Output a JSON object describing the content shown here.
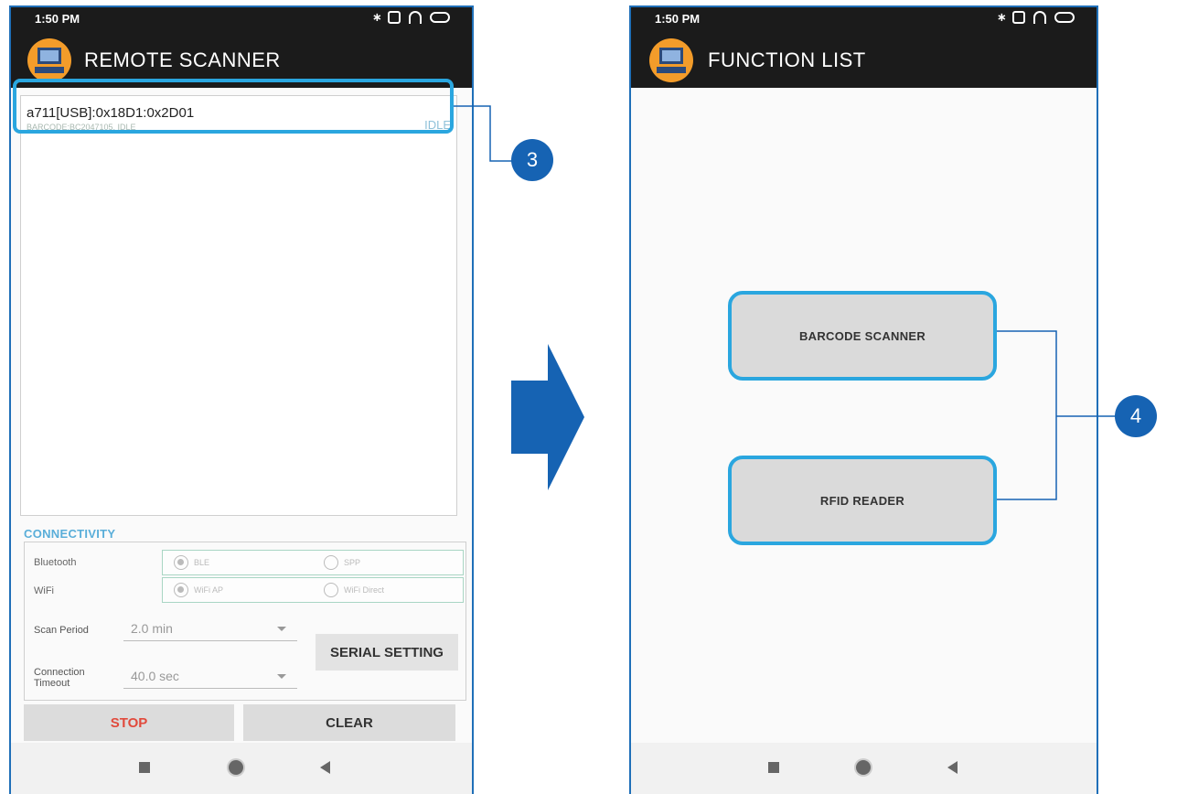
{
  "left_screen": {
    "status_time": "1:50 PM",
    "title": "REMOTE SCANNER",
    "device": {
      "name": "a711[USB]:0x18D1:0x2D01",
      "sub": "BARCODE:BC2047105, IDLE",
      "status": "IDLE"
    },
    "connectivity": {
      "label": "CONNECTIVITY",
      "bluetooth_label": "Bluetooth",
      "bluetooth_options": [
        "BLE",
        "SPP"
      ],
      "wifi_label": "WiFi",
      "wifi_options": [
        "WiFi AP",
        "WiFi Direct"
      ],
      "scan_period_label": "Scan Period",
      "scan_period_value": "2.0 min",
      "connection_timeout_label": "Connection Timeout",
      "connection_timeout_value": "40.0 sec",
      "serial_setting_label": "SERIAL SETTING"
    },
    "stop_label": "STOP",
    "clear_label": "CLEAR"
  },
  "right_screen": {
    "status_time": "1:50 PM",
    "title": "FUNCTION LIST",
    "barcode_label": "BARCODE SCANNER",
    "rfid_label": "RFID READER"
  },
  "callouts": {
    "step3": "3",
    "step4": "4"
  },
  "colors": {
    "highlight": "#2aa6df",
    "badge": "#1663b3",
    "stop": "#e14a3c",
    "appbar": "#1b1b1b"
  }
}
